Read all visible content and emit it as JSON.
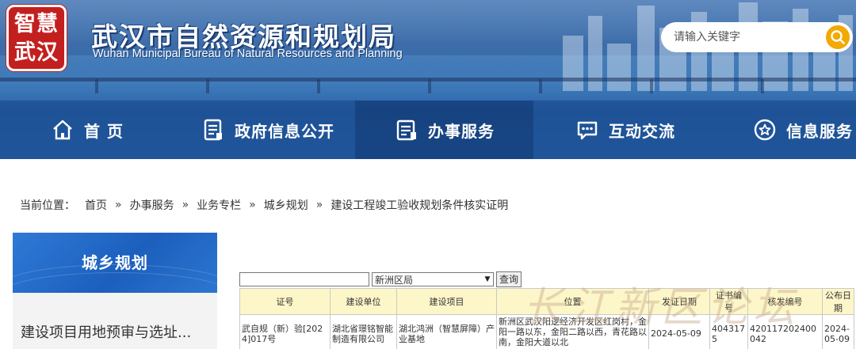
{
  "header": {
    "seal_chars": [
      "智慧",
      "武汉"
    ],
    "title": "武汉市自然资源和规划局",
    "subtitle": "Wuhan Municipal Bureau of Natural Resources and Planning",
    "search_placeholder": "请输入关键字"
  },
  "nav": {
    "items": [
      {
        "label": "首 页",
        "icon": "home-icon"
      },
      {
        "label": "政府信息公开",
        "icon": "document-icon"
      },
      {
        "label": "办事服务",
        "icon": "service-icon"
      },
      {
        "label": "互动交流",
        "icon": "chat-icon"
      },
      {
        "label": "信息服务",
        "icon": "star-icon"
      }
    ],
    "active_index": 2
  },
  "breadcrumb": {
    "lead": "当前位置：",
    "items": [
      "首页",
      "办事服务",
      "业务专栏",
      "城乡规划",
      "建设工程竣工验收规划条件核实证明"
    ],
    "separator": "»"
  },
  "sidebar": {
    "heading": "城乡规划",
    "items": [
      "建设项目用地预审与选址..."
    ]
  },
  "query": {
    "keyword_value": "",
    "district_selected": "新洲区局",
    "submit_label": "查询"
  },
  "table": {
    "columns": [
      "证号",
      "建设单位",
      "建设项目",
      "位置",
      "发证日期",
      "证书编号",
      "核发编号",
      "公布日期"
    ],
    "rows": [
      [
        "武自规（新）验[2024]017号",
        "湖北省璟铭智能制造有限公司",
        "湖北鸿洲（智慧屏障）产业基地",
        "新洲区武汉阳逻经济开发区红岗村，金阳一路以东，金阳二路以西，青花路以南，金阳大道以北",
        "2024-05-09",
        "4043175",
        "420117202400042",
        "2024-05-09"
      ]
    ]
  },
  "watermark": "长江新区论坛",
  "colors": {
    "seal_red": "#c41f1f",
    "nav_blue": "#18488c",
    "search_orange": "#f2a900",
    "sidebar_blue": "#1c5fbd",
    "table_header_bg": "#fdf6c8"
  }
}
